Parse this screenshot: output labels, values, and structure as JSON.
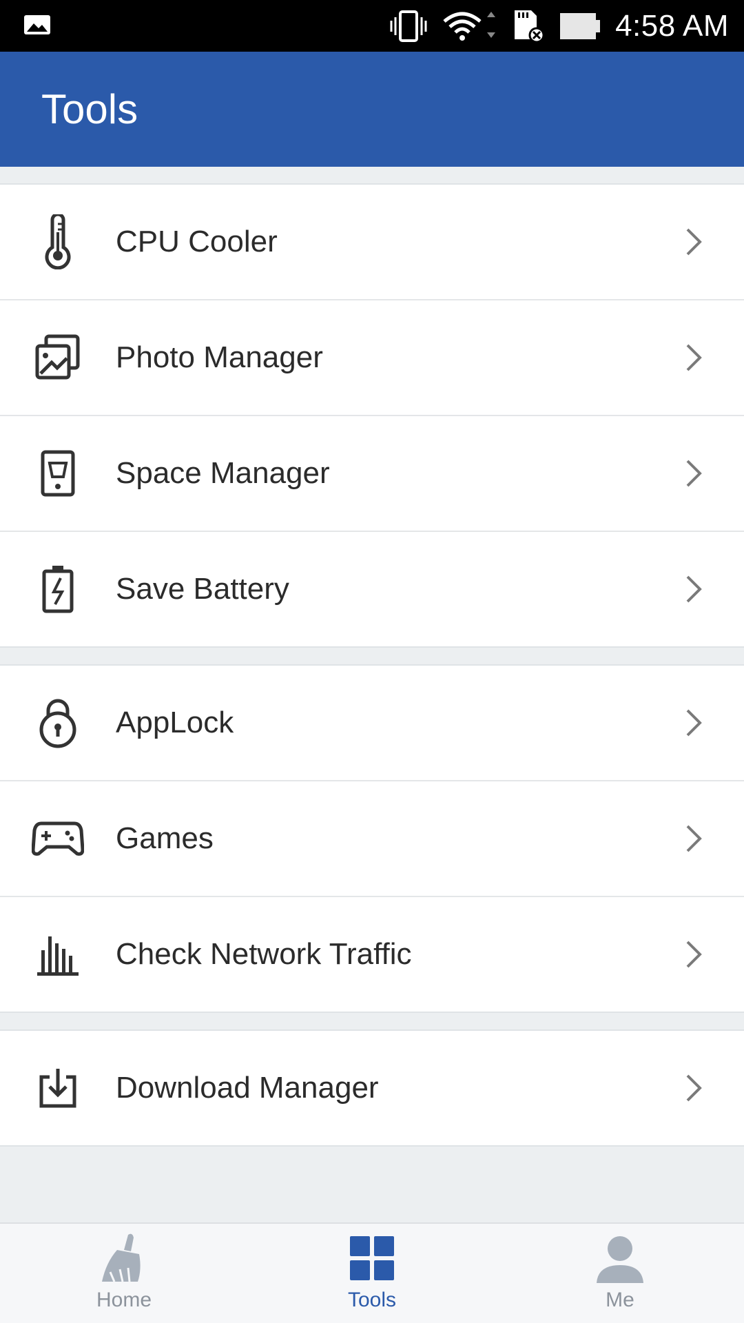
{
  "status_bar": {
    "time": "4:58 AM",
    "icons": [
      "image-notification-icon",
      "vibrate-icon",
      "wifi-icon",
      "sd-card-error-icon",
      "battery-icon"
    ]
  },
  "app_bar": {
    "title": "Tools"
  },
  "groups": [
    {
      "items": [
        {
          "label": "CPU Cooler",
          "icon": "thermometer-icon"
        },
        {
          "label": "Photo Manager",
          "icon": "photos-icon"
        },
        {
          "label": "Space Manager",
          "icon": "phone-storage-icon"
        },
        {
          "label": "Save Battery",
          "icon": "battery-bolt-icon"
        }
      ]
    },
    {
      "items": [
        {
          "label": "AppLock",
          "icon": "padlock-icon"
        },
        {
          "label": "Games",
          "icon": "gamepad-icon"
        },
        {
          "label": "Check Network Traffic",
          "icon": "bar-chart-icon"
        }
      ]
    },
    {
      "items": [
        {
          "label": "Download Manager",
          "icon": "download-icon"
        }
      ]
    }
  ],
  "bottom_nav": {
    "items": [
      {
        "label": "Home",
        "icon": "broom-icon",
        "active": false
      },
      {
        "label": "Tools",
        "icon": "grid-icon",
        "active": true
      },
      {
        "label": "Me",
        "icon": "user-icon",
        "active": false
      }
    ]
  },
  "colors": {
    "accent": "#2b5aaa",
    "status_bar": "#000000",
    "background": "#eceff1",
    "inactive_nav": "#8c939c"
  }
}
